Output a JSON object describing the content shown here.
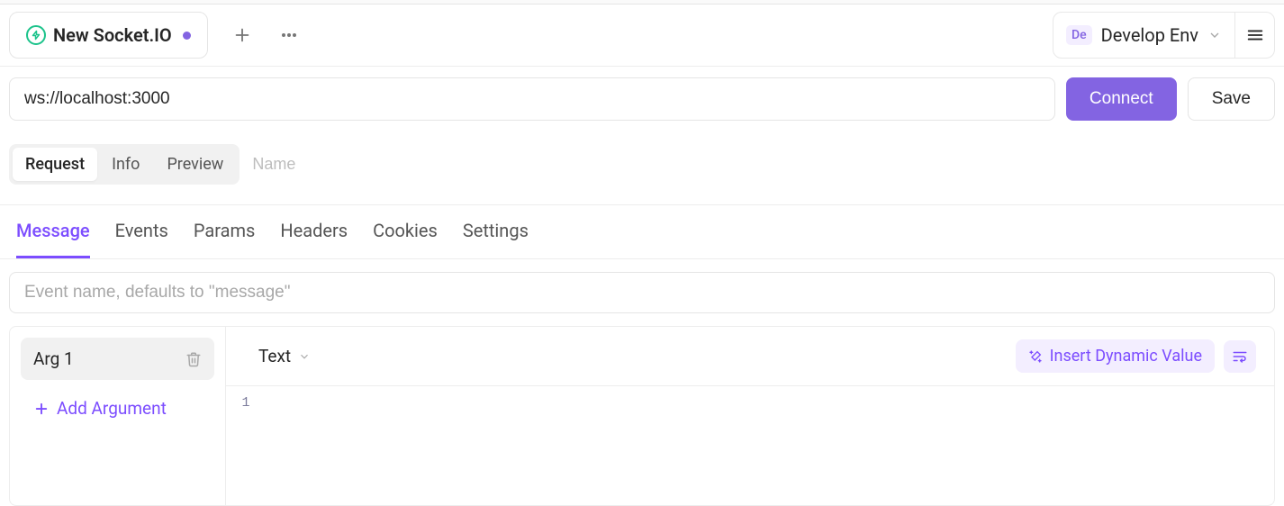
{
  "tab": {
    "title": "New Socket.IO",
    "modified": true
  },
  "env": {
    "badge": "De",
    "name": "Develop Env"
  },
  "url": {
    "value": "ws://localhost:3000",
    "connect_label": "Connect",
    "save_label": "Save"
  },
  "segmented": {
    "items": [
      "Request",
      "Info",
      "Preview"
    ],
    "name_placeholder": "Name"
  },
  "inner_tabs": [
    "Message",
    "Events",
    "Params",
    "Headers",
    "Cookies",
    "Settings"
  ],
  "event": {
    "placeholder": "Event name, defaults to \"message\""
  },
  "args": {
    "items": [
      "Arg 1"
    ],
    "add_label": "Add Argument"
  },
  "content": {
    "type_label": "Text",
    "insert_label": "Insert Dynamic Value",
    "line_numbers": [
      "1"
    ]
  }
}
